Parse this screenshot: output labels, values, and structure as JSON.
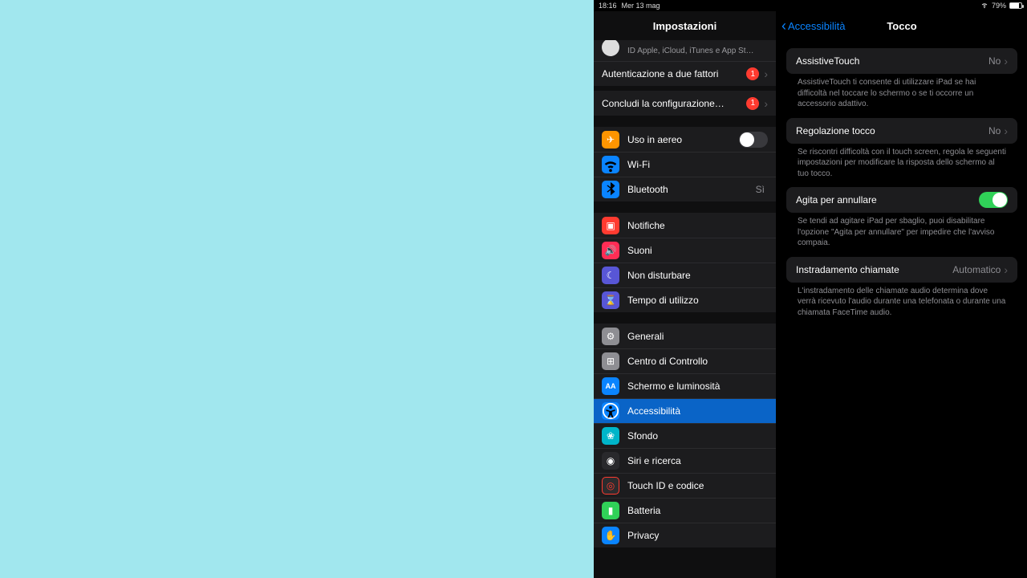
{
  "status": {
    "time": "18:16",
    "date": "Mer 13 mag",
    "battery_pct": "79%"
  },
  "sidebar": {
    "title": "Impostazioni",
    "account_sub": "ID Apple, iCloud, iTunes e App St…",
    "twofactor": {
      "label": "Autenticazione a due fattori",
      "badge": "1"
    },
    "finish": {
      "label": "Concludi la configurazione…",
      "badge": "1"
    },
    "airplane": {
      "label": "Uso in aereo"
    },
    "wifi": {
      "label": "Wi-Fi",
      "value": ""
    },
    "bluetooth": {
      "label": "Bluetooth",
      "value": "Sì"
    },
    "notifications": {
      "label": "Notifiche"
    },
    "sounds": {
      "label": "Suoni"
    },
    "dnd": {
      "label": "Non disturbare"
    },
    "screentime": {
      "label": "Tempo di utilizzo"
    },
    "general": {
      "label": "Generali"
    },
    "cc": {
      "label": "Centro di Controllo"
    },
    "display": {
      "label": "Schermo e luminosità"
    },
    "accessibility": {
      "label": "Accessibilità"
    },
    "wallpaper": {
      "label": "Sfondo"
    },
    "siri": {
      "label": "Siri e ricerca"
    },
    "touchid": {
      "label": "Touch ID e codice"
    },
    "battery": {
      "label": "Batteria"
    },
    "privacy": {
      "label": "Privacy"
    }
  },
  "detail": {
    "back": "Accessibilità",
    "title": "Tocco",
    "assistive": {
      "label": "AssistiveTouch",
      "value": "No",
      "note": "AssistiveTouch ti consente di utilizzare iPad se hai difficoltà nel toccare lo schermo o se ti occorre un accessorio adattivo."
    },
    "touchaccom": {
      "label": "Regolazione tocco",
      "value": "No",
      "note": "Se riscontri difficoltà con il touch screen, regola le seguenti impostazioni per modificare la risposta dello schermo al tuo tocco."
    },
    "shake": {
      "label": "Agita per annullare",
      "note": "Se tendi ad agitare iPad per sbaglio, puoi disabilitare l'opzione \"Agita per annullare\" per impedire che l'avviso compaia."
    },
    "callrouting": {
      "label": "Instradamento chiamate",
      "value": "Automatico",
      "note": "L'instradamento delle chiamate audio determina dove verrà ricevuto l'audio durante una telefonata o durante una chiamata FaceTime audio."
    }
  }
}
